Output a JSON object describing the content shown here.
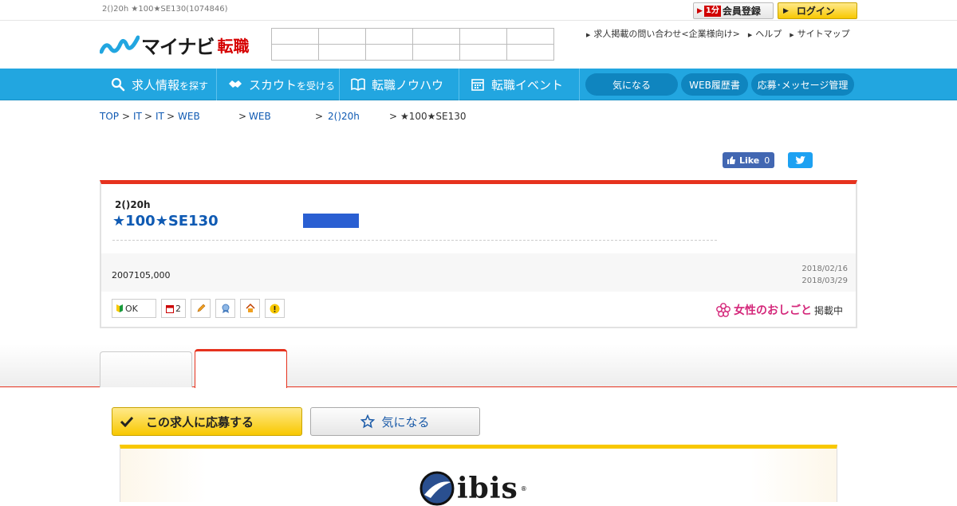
{
  "topbar": {
    "page_title": "2()20h ★100★SE130(1074846)",
    "register": {
      "badge": "1分",
      "label": "会員登録"
    },
    "login": {
      "label": "ログイン"
    }
  },
  "header": {
    "logo_text": "マイナビ",
    "logo_sub": "転職",
    "links": [
      "求人掲載の問い合わせ<企業様向け>",
      "ヘルプ",
      "サイトマップ"
    ]
  },
  "nav": {
    "items": [
      {
        "main": "求人情報",
        "small": "を探す",
        "icon": "search-icon"
      },
      {
        "main": "スカウト",
        "small": "を受ける",
        "icon": "handshake-icon"
      },
      {
        "main": "転職ノウハウ",
        "small": "",
        "icon": "book-icon"
      },
      {
        "main": "転職イベント",
        "small": "",
        "icon": "calendar-icon"
      }
    ],
    "pills": [
      "気になる",
      "WEB履歴書",
      "応募･メッセージ管理"
    ]
  },
  "breadcrumb": [
    "TOP",
    "IT",
    "IT",
    "WEB",
    "WEB",
    "2()20h",
    "★100★SE130"
  ],
  "social": {
    "like_label": "Like",
    "like_count": "0"
  },
  "job": {
    "company": "2()20h",
    "title": "★100★SE130",
    "salary": "2007105,000",
    "date_posted": "2018/02/16",
    "date_end": "2018/03/29",
    "icons": [
      {
        "name": "beginner-ok-icon",
        "text": "OK"
      },
      {
        "name": "holiday-icon",
        "text": "2"
      },
      {
        "name": "pencil-icon",
        "text": ""
      },
      {
        "name": "award-icon",
        "text": ""
      },
      {
        "name": "house-icon",
        "text": ""
      },
      {
        "name": "alert-icon",
        "text": ""
      }
    ],
    "women_label": "女性のおしごと",
    "women_suffix": "掲載中"
  },
  "actions": {
    "apply": "この求人に応募する",
    "favorite": "気になる"
  },
  "banner": {
    "logo": "ibis",
    "logo_mark": "®"
  },
  "colors": {
    "nav_blue": "#22a6e0",
    "accent_red": "#e6321e",
    "link_blue": "#0f5ab3",
    "yellow": "#f8c800"
  }
}
